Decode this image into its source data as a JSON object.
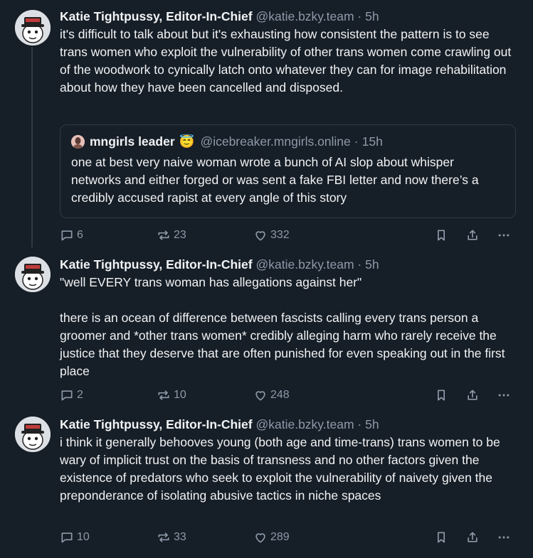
{
  "posts": [
    {
      "author": "Katie Tightpussy, Editor-In-Chief",
      "handle": "@katie.bzky.team",
      "dot": "·",
      "time": "5h",
      "text": "it's difficult to talk about but it's exhausting how consistent the pattern is to see trans women who exploit the vulnerability of other trans women come crawling out of the woodwork to cynically latch onto whatever they can for image rehabilitation about how they have been cancelled and disposed.",
      "quote": {
        "author": "mngirls leader",
        "emoji": "😇",
        "handle": "@icebreaker.mngirls.online",
        "dot": "·",
        "time": "15h",
        "text": "one at best very naive woman wrote a bunch of AI slop about whisper networks and either forged or was sent a fake FBI letter and now there’s a credibly accused rapist at every angle of this story"
      },
      "replies": "6",
      "reposts": "23",
      "likes": "332"
    },
    {
      "author": "Katie Tightpussy, Editor-In-Chief",
      "handle": "@katie.bzky.team",
      "dot": "·",
      "time": "5h",
      "text": "\"well EVERY trans woman has allegations against her\"\n\nthere is an ocean of difference between fascists calling every trans person a groomer and *other trans women* credibly alleging harm who rarely receive the justice that they deserve that are often punished for even speaking out in the first place",
      "replies": "2",
      "reposts": "10",
      "likes": "248"
    },
    {
      "author": "Katie Tightpussy, Editor-In-Chief",
      "handle": "@katie.bzky.team",
      "dot": "·",
      "time": "5h",
      "text": "i think it generally behooves young (both age and time-trans) trans women to be wary of implicit trust on the basis of transness and no other factors given the existence of predators who seek to exploit the vulnerability of naivety given the preponderance of isolating abusive tactics in niche spaces",
      "replies": "10",
      "reposts": "33",
      "likes": "289"
    }
  ],
  "icons": {
    "reply": "speech-bubble-icon",
    "repost": "repost-arrows-icon",
    "like": "heart-icon",
    "bookmark": "bookmark-icon",
    "share": "share-icon",
    "more": "ellipsis-icon"
  },
  "colors": {
    "background": "#161e27",
    "text": "#f1f3f5",
    "muted": "#8d9aa9",
    "border": "#2e3a47"
  }
}
